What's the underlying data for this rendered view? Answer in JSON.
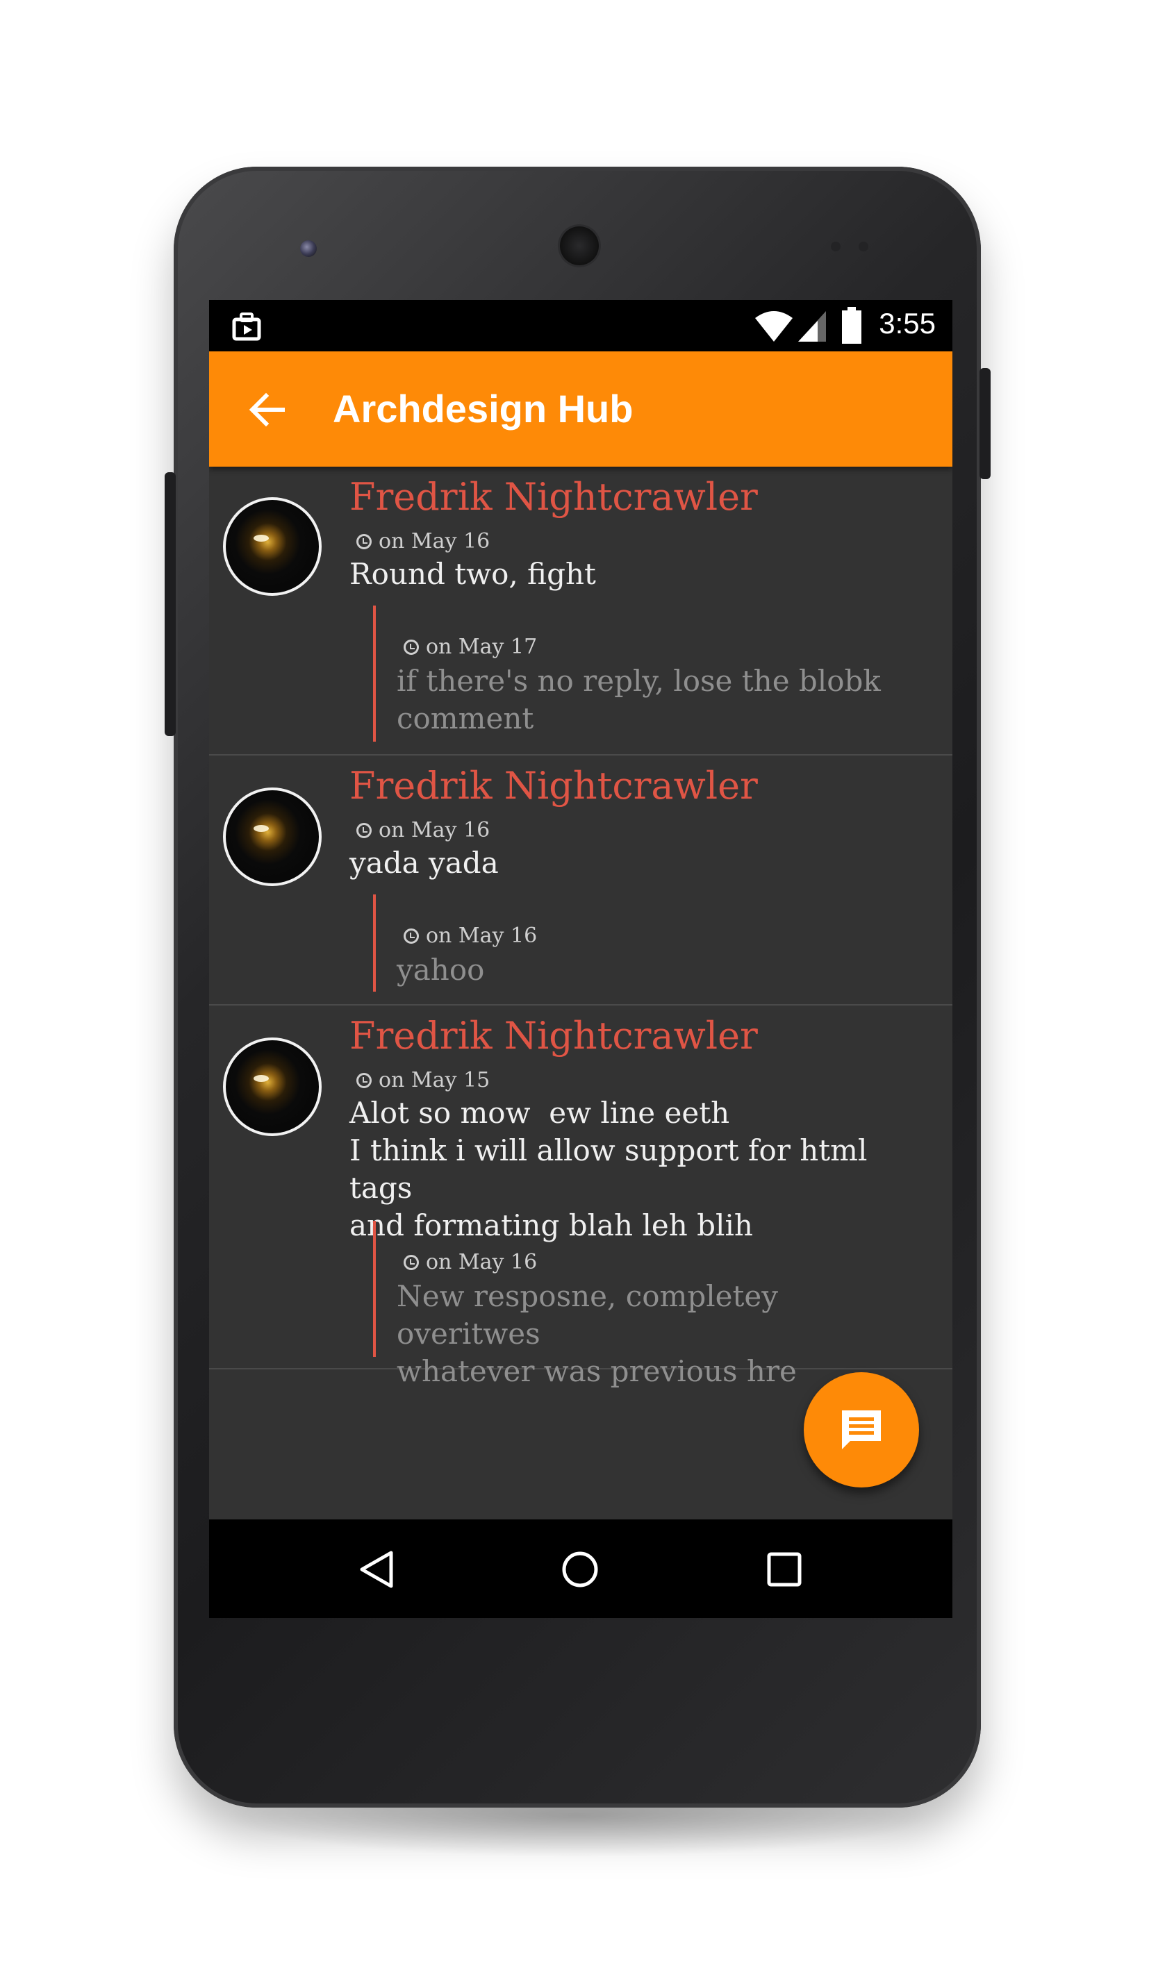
{
  "status_bar": {
    "time": "3:55",
    "icons": [
      "notification-icon",
      "wifi-icon",
      "signal-icon",
      "battery-icon"
    ]
  },
  "toolbar": {
    "title": "Archdesign Hub",
    "back_icon": "arrow-back-icon",
    "background_color": "#fe8a07"
  },
  "comments": [
    {
      "author": "Fredrik Nightcrawler",
      "date": "on May 16",
      "body": "Round two, fight",
      "reply": {
        "date": "on May 17",
        "lines": [
          "if there's no reply, lose the blobk",
          "comment"
        ]
      }
    },
    {
      "author": "Fredrik Nightcrawler",
      "date": "on May 16",
      "body": "yada yada",
      "reply": {
        "date": "on May 16",
        "lines": [
          "yahoo"
        ]
      }
    },
    {
      "author": "Fredrik Nightcrawler",
      "date": "on May 15",
      "body_lines": [
        "Alot so mow  ew line eeth",
        "I think i will allow support for html tags",
        "and formating blah leh blih"
      ],
      "reply": {
        "date": "on May 16",
        "lines": [
          "New resposne, completey overitwes",
          "whatever was previous hre"
        ]
      }
    }
  ],
  "fab": {
    "icon": "comment-icon"
  },
  "nav_bar": {
    "icons": [
      "back-triangle-icon",
      "home-circle-icon",
      "recents-square-icon"
    ]
  },
  "colors": {
    "accent": "#fe8a07",
    "author_name": "#e05545",
    "reply_bar": "#e05545",
    "screen_background": "#333333"
  }
}
